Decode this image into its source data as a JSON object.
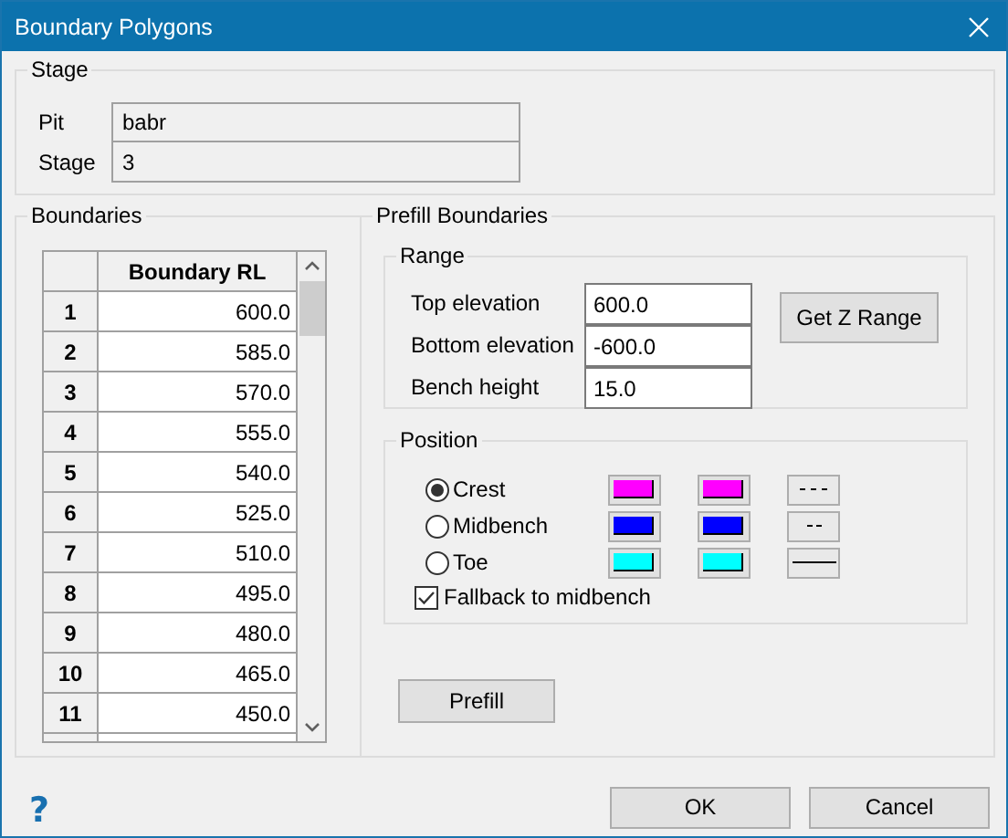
{
  "window": {
    "title": "Boundary Polygons"
  },
  "stage": {
    "title": "Stage",
    "fields": [
      {
        "label": "Pit",
        "value": "babr"
      },
      {
        "label": "Stage",
        "value": "3"
      }
    ]
  },
  "boundaries": {
    "title": "Boundaries",
    "column": "Boundary RL",
    "rows": [
      {
        "index": "1",
        "value": "600.0"
      },
      {
        "index": "2",
        "value": "585.0"
      },
      {
        "index": "3",
        "value": "570.0"
      },
      {
        "index": "4",
        "value": "555.0"
      },
      {
        "index": "5",
        "value": "540.0"
      },
      {
        "index": "6",
        "value": "525.0"
      },
      {
        "index": "7",
        "value": "510.0"
      },
      {
        "index": "8",
        "value": "495.0"
      },
      {
        "index": "9",
        "value": "480.0"
      },
      {
        "index": "10",
        "value": "465.0"
      },
      {
        "index": "11",
        "value": "450.0"
      }
    ]
  },
  "prefill": {
    "title": "Prefill Boundaries",
    "range": {
      "title": "Range",
      "fields": [
        {
          "label": "Top elevation",
          "value": "600.0"
        },
        {
          "label": "Bottom elevation",
          "value": "-600.0"
        },
        {
          "label": "Bench height",
          "value": "15.0"
        }
      ],
      "button": "Get Z Range"
    },
    "position": {
      "title": "Position",
      "options": [
        {
          "label": "Crest",
          "selected": true,
          "swatches": [
            {
              "color": "#ff00ff"
            },
            {
              "color": "#ff00ff"
            }
          ],
          "line": {
            "kind": "dash-dot"
          }
        },
        {
          "label": "Midbench",
          "selected": false,
          "swatches": [
            {
              "color": "#0000ff"
            },
            {
              "color": "#0000ff"
            }
          ],
          "line": {
            "kind": "dash"
          }
        },
        {
          "label": "Toe",
          "selected": false,
          "swatches": [
            {
              "color": "#00ffff"
            },
            {
              "color": "#00ffff"
            }
          ],
          "line": {
            "kind": "solid"
          }
        }
      ],
      "fallback": {
        "label": "Fallback to midbench",
        "checked": true
      }
    },
    "button": "Prefill"
  },
  "footer": {
    "help": "?",
    "buttons": [
      "OK",
      "Cancel"
    ]
  }
}
